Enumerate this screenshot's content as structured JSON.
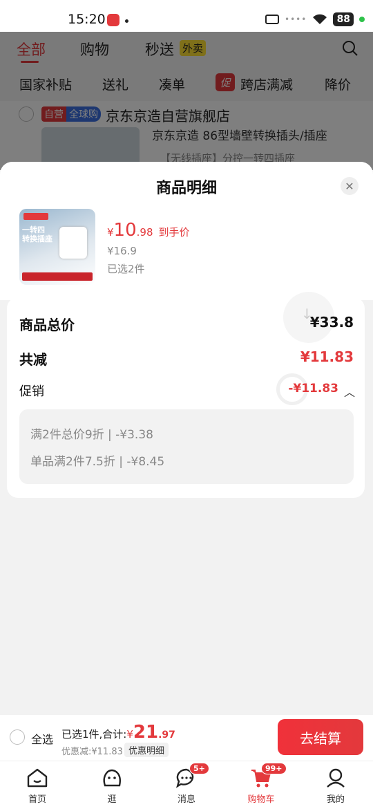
{
  "status_bar": {
    "time": "15:20",
    "battery": "88"
  },
  "background": {
    "tabs": [
      "全部",
      "购物",
      "秒送"
    ],
    "waimai_tag": "外卖",
    "chips": [
      "国家补贴",
      "送礼",
      "凑单",
      "跨店满减",
      "降价"
    ],
    "promo_tag": "促",
    "store_tag_self": "自营",
    "store_tag_global": "全球购",
    "store_name": "京东京造自营旗舰店",
    "item_title_partial": "京东京造 86型墙壁转换插头/插座",
    "item_spec_partial": "【无线插座】分控一转四插座"
  },
  "sheet": {
    "title": "商品明细",
    "product": {
      "price_currency": "¥",
      "price_int": "10",
      "price_dec": ".98",
      "price_label": "到手价",
      "original_price": "¥16.9",
      "selected": "已选2件",
      "image_text": "一转四\n转换插座"
    },
    "summary": {
      "total_label": "商品总价",
      "total_value": "¥33.8",
      "reduce_label": "共减",
      "reduce_value": "¥11.83",
      "promo_label": "促销",
      "promo_value": "-¥11.83",
      "promo_items": [
        "满2件总价9折 | -¥3.38",
        "单品满2件7.5折 | -¥8.45"
      ]
    }
  },
  "checkout": {
    "select_all": "全选",
    "sum_prefix": "已选1件,合计:",
    "sum_currency": "¥",
    "sum_int": "21",
    "sum_dec": ".97",
    "discount": "优惠减:¥11.83",
    "detail_button": "优惠明细",
    "checkout_button": "去结算"
  },
  "nav": {
    "items": [
      {
        "label": "首页",
        "icon": "home-icon"
      },
      {
        "label": "逛",
        "icon": "browse-icon"
      },
      {
        "label": "消息",
        "icon": "message-icon",
        "badge": "5+"
      },
      {
        "label": "购物车",
        "icon": "cart-icon",
        "badge": "99+"
      },
      {
        "label": "我的",
        "icon": "profile-icon"
      }
    ]
  },
  "colors": {
    "accent": "#e3393c"
  }
}
